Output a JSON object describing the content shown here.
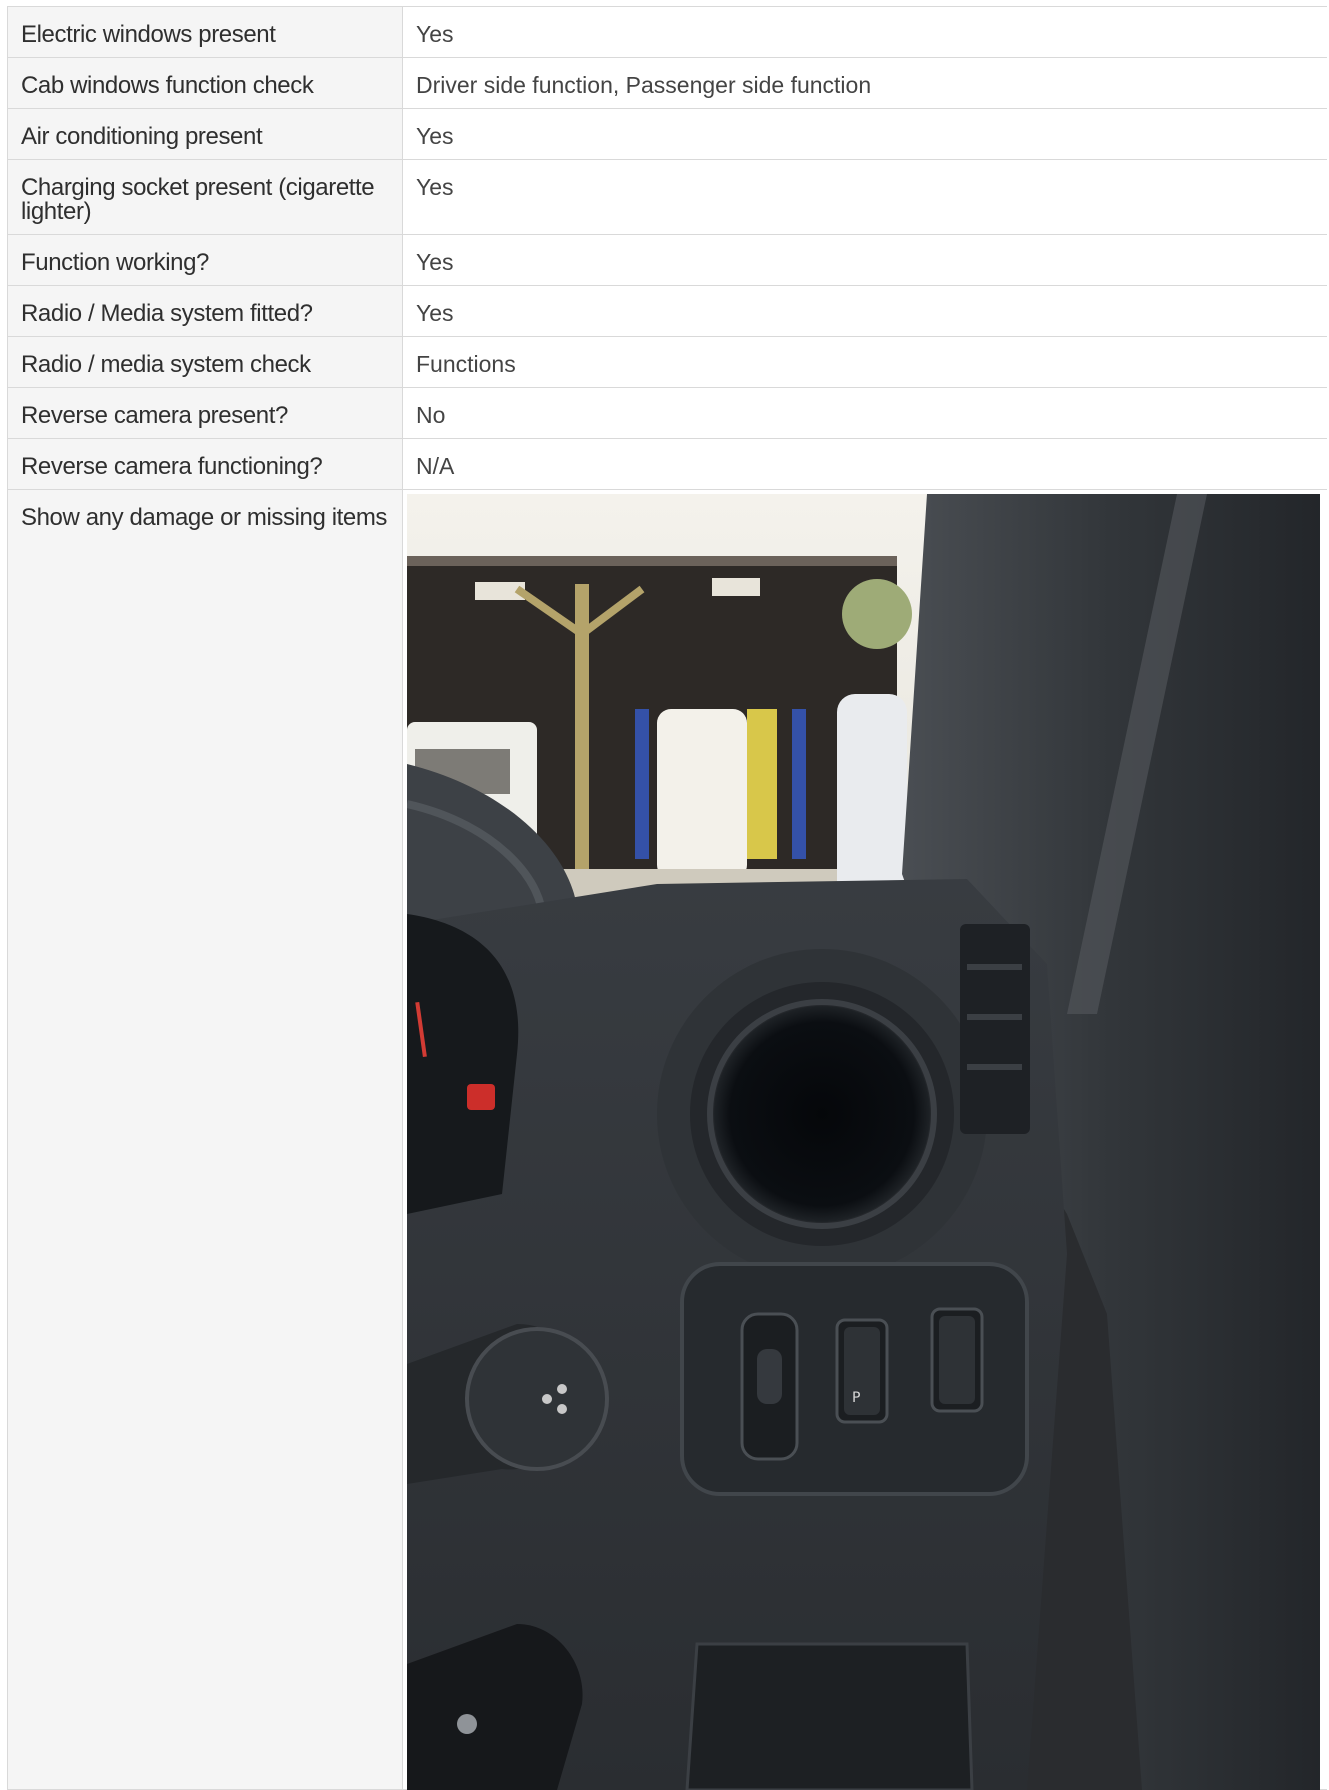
{
  "rows": [
    {
      "label": "Electric windows present",
      "value": "Yes"
    },
    {
      "label": "Cab windows function check",
      "value": "Driver side function, Passenger side function"
    },
    {
      "label": "Air conditioning present",
      "value": "Yes"
    },
    {
      "label": "Charging socket present (cigarette lighter)",
      "value": "Yes"
    },
    {
      "label": "Function working?",
      "value": "Yes"
    },
    {
      "label": "Radio / Media system fitted?",
      "value": "Yes"
    },
    {
      "label": "Radio / media system check",
      "value": "Functions"
    },
    {
      "label": "Reverse camera present?",
      "value": "No"
    },
    {
      "label": "Reverse camera functioning?",
      "value": "N/A"
    },
    {
      "label": "Show any damage or missing items",
      "value": ""
    }
  ],
  "colors": {
    "label_bg": "#f5f5f5",
    "border": "#d9d9d9",
    "dash_dark": "#2a2c2f"
  }
}
